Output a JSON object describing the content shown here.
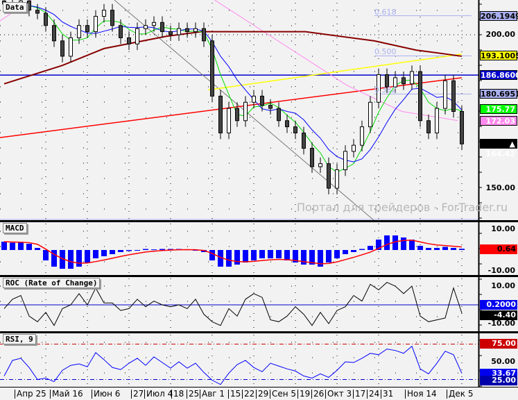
{
  "chart_data": {
    "type": "candlestick",
    "title": "Data",
    "watermark": "Портал для трейдеров - ForTrader.ru",
    "x_labels": [
      "Апр 25",
      "Май 16",
      "Июн 6",
      "27",
      "Июл 4",
      "18",
      "25",
      "Авг 1",
      "15",
      "22",
      "29",
      "Сен 5",
      "19",
      "26",
      "Окт 3",
      "17",
      "24",
      "31",
      "Ноя 14",
      "Дек 5"
    ],
    "price_axis": {
      "ylim": [
        139.4,
        211.3
      ],
      "ticks": [
        "200.00",
        "150.00"
      ]
    },
    "close": [
      210,
      209,
      211,
      208,
      207,
      203,
      198,
      193,
      199,
      203,
      201,
      206,
      208,
      203,
      199,
      197,
      202,
      203,
      204,
      201,
      200,
      202,
      201,
      202,
      198,
      180,
      168,
      176,
      172,
      178,
      180,
      177,
      176,
      172,
      170,
      168,
      163,
      157,
      158,
      150,
      156,
      162,
      164,
      170,
      178,
      187,
      183,
      186,
      184,
      188,
      172,
      168,
      176,
      185,
      175,
      164.42
    ],
    "ma_long": [
      [
        0,
        184
      ],
      [
        7,
        190
      ],
      [
        12,
        195.5
      ],
      [
        19.5,
        199.5
      ],
      [
        23.7,
        201
      ],
      [
        36.2,
        201
      ],
      [
        44.5,
        198
      ],
      [
        49.5,
        195
      ],
      [
        55,
        193
      ]
    ],
    "lines": {
      "red_trend": [
        [
          -0.5,
          166.5
        ],
        [
          55,
          186
        ]
      ],
      "yellow_trend": [
        [
          24.5,
          182
        ],
        [
          55,
          193.7
        ]
      ],
      "gray_trend": [
        [
          13.25,
          211.3
        ],
        [
          44.5,
          139.4
        ]
      ],
      "pink_a": [
        [
          -0.5,
          204.5
        ],
        [
          3.25,
          211.3
        ]
      ],
      "pink_b": [
        [
          25.3,
          211.3
        ],
        [
          41.2,
          183.5
        ],
        [
          47.8,
          175
        ],
        [
          54.5,
          172.03
        ]
      ],
      "blue_level": 186.86
    },
    "fib_levels": [
      {
        "label": "0.618",
        "value": 206.1949
      },
      {
        "label": "0.500",
        "value": 193.1005
      },
      {
        "label": "0.382",
        "value": 180.6951
      }
    ],
    "price_tags": [
      {
        "text": "206.1949",
        "value": 206.1949,
        "bg": "#aab0ee",
        "fg": "#000000"
      },
      {
        "text": "193.1005",
        "value": 193.1005,
        "bg": "#ffff00",
        "fg": "#000000"
      },
      {
        "text": "186.8600",
        "value": 186.86,
        "bg": "#0000cc",
        "fg": "#ffffff"
      },
      {
        "text": "180.6951",
        "value": 180.6951,
        "bg": "#aab0ee",
        "fg": "#000000"
      },
      {
        "text": "175.77",
        "value": 175.77,
        "bg": "#00ff00",
        "fg": "#ffffff"
      },
      {
        "text": "172.03",
        "value": 172.03,
        "bg": "#ff88ee",
        "fg": "#ffffff"
      },
      {
        "text": "▲ 164.42",
        "value": 164.42,
        "bg": "#000000",
        "fg": "#ffffff"
      }
    ],
    "macd": {
      "title": "MACD",
      "ticks": [
        "10.00",
        "-10.00"
      ],
      "last": "0.64",
      "histogram": [
        4,
        3.5,
        3.5,
        3,
        1,
        -5,
        -8,
        -9,
        -9,
        -8,
        -6,
        -4,
        -3,
        -2,
        -1,
        -0.5,
        0,
        0.5,
        0.3,
        0.5,
        0.5,
        0.5,
        0.3,
        0,
        -1,
        -5,
        -8,
        -8,
        -7,
        -6,
        -5,
        -4,
        -4,
        -4,
        -5,
        -6,
        -7,
        -7,
        -8,
        -6,
        -4,
        -2,
        -1,
        0.5,
        2,
        5,
        7,
        7,
        6,
        5,
        2,
        1,
        1,
        1.5,
        1,
        0.6
      ]
    },
    "roc": {
      "title": "ROC (Rate of Change)",
      "ticks": [
        "10.00",
        "-10.00"
      ],
      "level": "0.2000",
      "last": "-4.40",
      "values": [
        -2,
        3,
        5,
        -6,
        -9,
        -4,
        -11,
        -2,
        0,
        6,
        0,
        9,
        1,
        1,
        -3,
        -2,
        3,
        -1,
        2,
        0,
        -1,
        0,
        -2,
        3,
        -5,
        -9,
        -11,
        -2,
        -6,
        3,
        6,
        4,
        -8,
        -9,
        -6,
        -1,
        -5,
        -11,
        -4,
        -10,
        -3,
        -1,
        5,
        2,
        11,
        8,
        12,
        10,
        6,
        10,
        -6,
        -9,
        -8,
        -7,
        9,
        -4.4
      ]
    },
    "rsi": {
      "title": "RSI, 9",
      "levels": [
        "75.00",
        "25.00"
      ],
      "ticks": [
        "50.00"
      ],
      "last": "33.67",
      "values": [
        30,
        52,
        55,
        42,
        25,
        27,
        22,
        38,
        45,
        47,
        43,
        63,
        53,
        42,
        39,
        48,
        55,
        45,
        57,
        49,
        41,
        50,
        41,
        48,
        35,
        24,
        18,
        34,
        46,
        52,
        42,
        36,
        48,
        44,
        40,
        37,
        30,
        27,
        33,
        28,
        38,
        50,
        49,
        55,
        62,
        60,
        68,
        66,
        62,
        72,
        40,
        33,
        48,
        65,
        60,
        33.67
      ]
    }
  }
}
